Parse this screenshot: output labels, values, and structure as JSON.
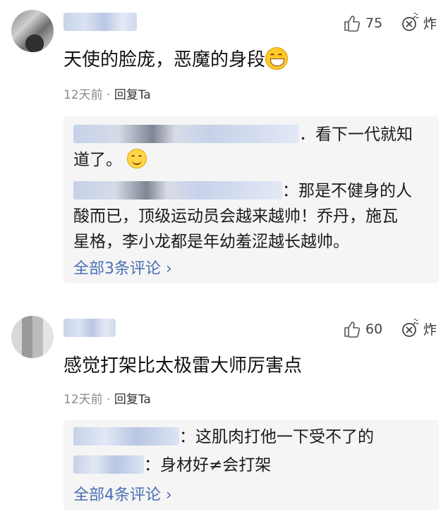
{
  "comments": [
    {
      "like_count": "75",
      "bomb_label": "炸",
      "text": "天使的脸庞，恶魔的身段",
      "emoji": "grinning-face-icon",
      "time": "12天前",
      "dot": "·",
      "reply_label": "回复Ta",
      "replies": [
        {
          "text_a": "．看下一代就知",
          "text_b": "道了。"
        },
        {
          "text_a": "：那是不健身的人",
          "text_b": "酸而已，顶级运动员会越来越帅！乔丹，施瓦",
          "text_c": "星格，李小龙都是年幼羞涩越长越帅。"
        }
      ],
      "all_label": "全部3条评论",
      "chevron": "›"
    },
    {
      "like_count": "60",
      "bomb_label": "炸",
      "text": "感觉打架比太极雷大师厉害点",
      "time": "12天前",
      "dot": "·",
      "reply_label": "回复Ta",
      "replies": [
        {
          "text_a": "：这肌肉打他一下受不了的"
        },
        {
          "text_a": "：身材好≠会打架"
        }
      ],
      "all_label": "全部4条评论",
      "chevron": "›"
    }
  ],
  "colors": {
    "link": "#4a6fb5",
    "meta": "#8a8a8a",
    "reply_bg": "#f5f5f5"
  }
}
